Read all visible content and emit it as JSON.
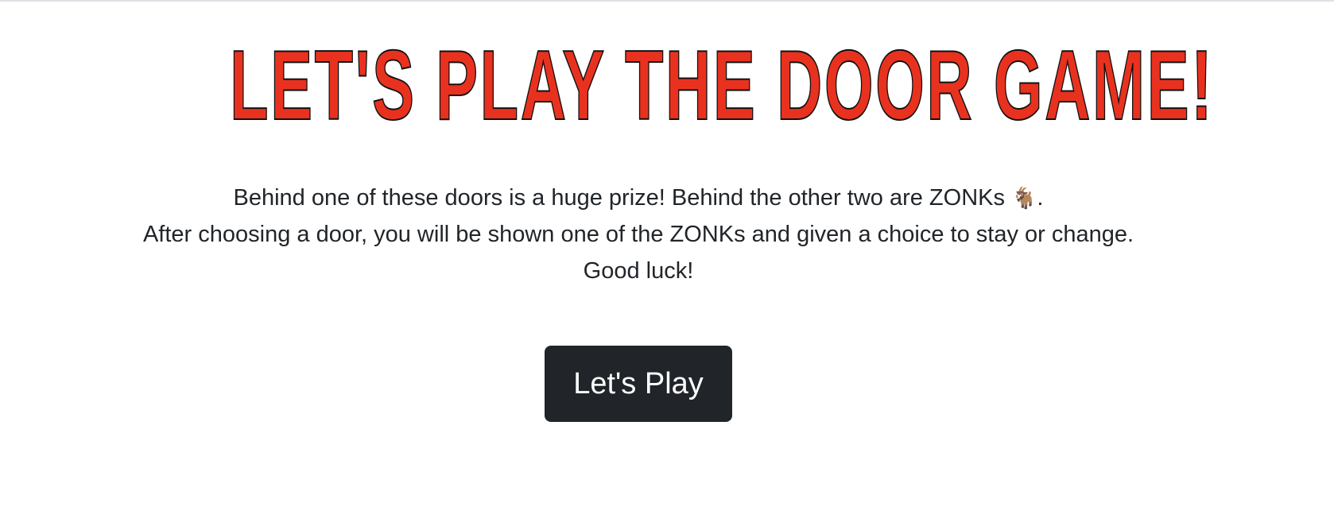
{
  "header": {
    "title": "LET'S PLAY THE DOOR GAME!"
  },
  "intro": {
    "line1_text": "Behind one of these doors is a huge prize! Behind the other two are ZONKs",
    "line1_icon": "🐐",
    "line1_end": ".",
    "line2": "After choosing a door, you will be shown one of the ZONKs and given a choice to stay or change.",
    "line3": "Good luck!"
  },
  "actions": {
    "play_label": "Let's Play"
  },
  "colors": {
    "title_fill": "#e8321f",
    "title_outline": "#111111",
    "button_bg": "#212529",
    "button_text": "#ffffff",
    "body_text": "#212529"
  },
  "icons": {
    "goat": "goat-icon"
  }
}
